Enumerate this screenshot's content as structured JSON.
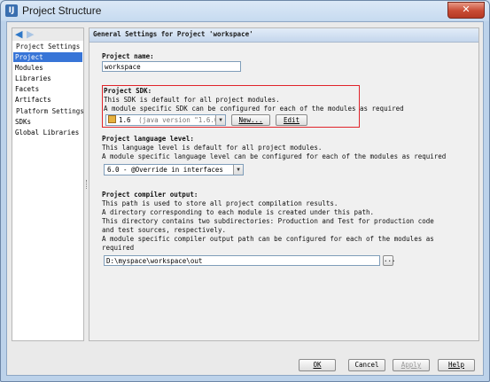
{
  "window": {
    "title": "Project Structure",
    "close_glyph": "✕",
    "app_icon_text": "IJ"
  },
  "nav": {
    "back_icon": "◀",
    "forward_icon": "▶",
    "project_settings_header": "Project Settings",
    "project_settings_items": [
      "Project",
      "Modules",
      "Libraries",
      "Facets",
      "Artifacts"
    ],
    "platform_settings_header": "Platform Settings",
    "platform_settings_items": [
      "SDKs",
      "Global Libraries"
    ],
    "selected": "Project"
  },
  "general": {
    "header": "General Settings for Project 'workspace'",
    "project_name_label": "Project name:",
    "project_name_value": "workspace",
    "sdk_label": "Project SDK:",
    "sdk_desc1": "This SDK is default for all project modules.",
    "sdk_desc2": "A module specific SDK can be configured for each of the modules as required",
    "sdk_value": "1.6",
    "sdk_version": "(java version \"1.6.0_31\")",
    "sdk_new_button": "New...",
    "sdk_edit_button": "Edit",
    "lang_label": "Project language level:",
    "lang_desc1": "This language level is default for all project modules.",
    "lang_desc2": "A module specific language level can be configured for each of the modules as required",
    "lang_value": "6.0 - @Override in interfaces",
    "output_label": "Project compiler output:",
    "output_desc1": "This path is used to store all project compilation results.",
    "output_desc2": "A directory corresponding to each module is created under this path.",
    "output_desc3": "This directory contains two subdirectories: Production and Test for production code",
    "output_desc4": "and test sources, respectively.",
    "output_desc5": "A module specific compiler output path can be configured for each of the modules as",
    "output_desc6": "required",
    "output_value": "D:\\myspace\\workspace\\out",
    "browse_button": "..."
  },
  "footer": {
    "ok": "OK",
    "cancel": "Cancel",
    "apply": "Apply",
    "help": "Help"
  }
}
